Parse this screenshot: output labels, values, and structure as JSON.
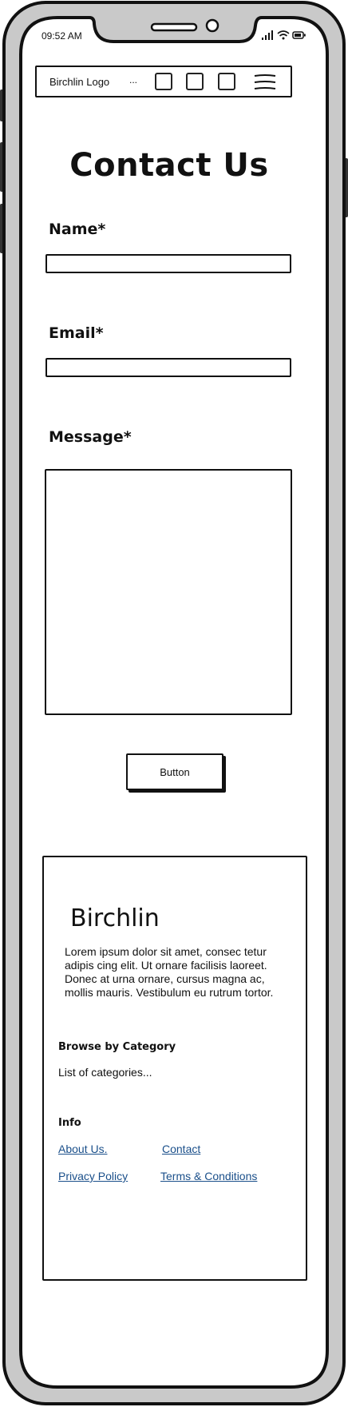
{
  "status_bar": {
    "time": "09:52 AM",
    "icons": [
      "signal-icon",
      "wifi-icon",
      "battery-icon"
    ]
  },
  "navbar": {
    "logo": "Birchlin Logo",
    "ellipsis": "...",
    "icons": [
      "square-icon",
      "square-icon",
      "square-icon",
      "hamburger-menu-icon"
    ]
  },
  "page": {
    "title": "Contact Us"
  },
  "form": {
    "name_label": "Name*",
    "name_value": "",
    "email_label": "Email*",
    "email_value": "",
    "message_label": "Message*",
    "message_value": "",
    "submit_label": "Button"
  },
  "footer": {
    "brand": "Birchlin",
    "description": "Lorem ipsum dolor sit amet, consec tetur adipis cing elit. Ut ornare facilisis laoreet. Donec at urna ornare, cursus magna ac, mollis mauris. Vestibulum eu rutrum tortor.",
    "browse_heading": "Browse by Category",
    "categories_text": "List of categories...",
    "info_heading": "Info",
    "links": {
      "about": "About Us.",
      "contact": "Contact",
      "privacy": "Privacy Policy",
      "terms": "Terms & Conditions"
    }
  }
}
